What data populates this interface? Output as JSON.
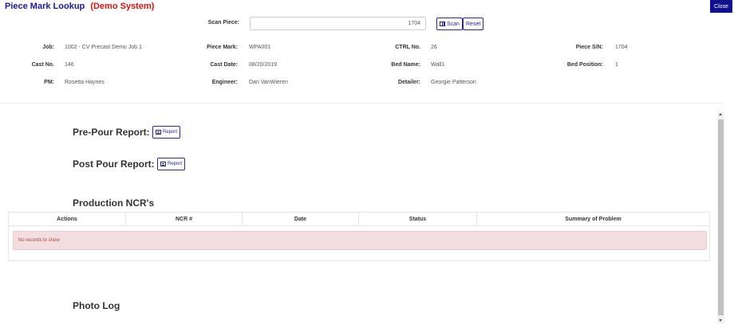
{
  "header": {
    "title": "Piece Mark Lookup",
    "subtitle": "(Demo System)",
    "close_label": "Close"
  },
  "scan": {
    "label": "Scan Piece:",
    "value": "1704",
    "scan_label": "Scan",
    "reset_label": "Reset"
  },
  "info": {
    "job_label": "Job:",
    "job": "1002 - CV Precast Demo Job 1",
    "piece_mark_label": "Piece Mark:",
    "piece_mark": "WPA001",
    "ctrl_no_label": "CTRL No.",
    "ctrl_no": "26",
    "piece_sn_label": "Piece S/N:",
    "piece_sn": "1704",
    "cast_no_label": "Cast No.",
    "cast_no": "146",
    "cast_date_label": "Cast Date:",
    "cast_date": "08/20/2019",
    "bed_name_label": "Bed Name:",
    "bed_name": "Wall1",
    "bed_position_label": "Bed Position:",
    "bed_position": "1",
    "pm_label": "PM:",
    "pm": "Rosetta Haynes",
    "engineer_label": "Engineer:",
    "engineer": "Dan VanWieren",
    "detailer_label": "Detailer:",
    "detailer": "Georgie Patterson"
  },
  "reports": {
    "pre_pour_title": "Pre-Pour Report:",
    "post_pour_title": "Post Pour Report:",
    "button_label": "Report"
  },
  "ncr": {
    "title": "Production NCR's",
    "columns": [
      "Actions",
      "NCR #",
      "Date",
      "Status",
      "Summary of Problem"
    ],
    "empty_message": "No records to show"
  },
  "photo_log": {
    "title": "Photo Log"
  },
  "colors": {
    "title": "#1a1aa0",
    "demo": "#e01010",
    "primary_button": "#11118f",
    "empty_bg": "#f2dede"
  }
}
